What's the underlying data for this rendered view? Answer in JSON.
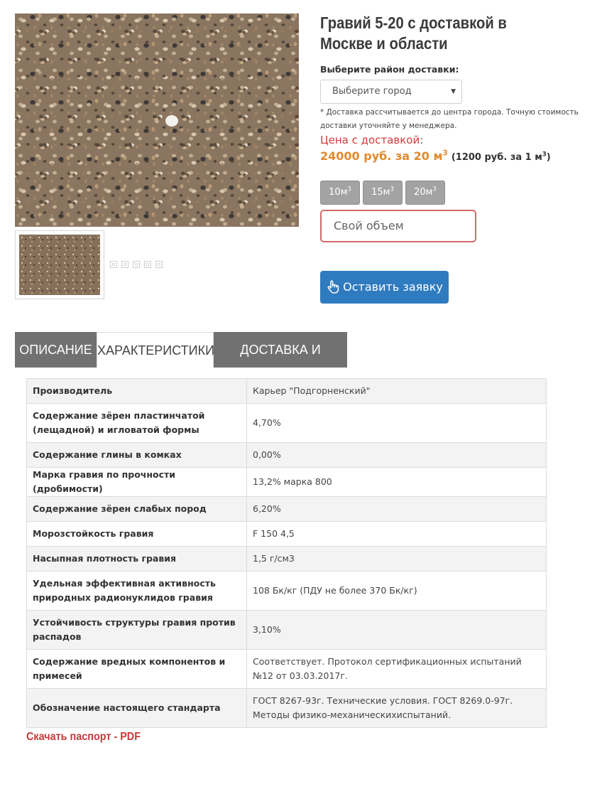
{
  "product": {
    "title": "Гравий 5-20 с доставкой в Москве и области"
  },
  "delivery": {
    "district_label": "Выберите район доставки:",
    "city_select_value": "Выберите город",
    "note": "* Доставка рассчитывается до центра города. Точную стоимость доставки уточняйте у менеджера."
  },
  "price": {
    "label": "Цена с доставкой:",
    "main_text": "24000 руб. за 20 м",
    "main_sup": "3",
    "unit_text": "(1200 руб. за 1 м",
    "unit_sup": "3",
    "unit_close": ")"
  },
  "volume_buttons": [
    {
      "label": "10м",
      "sup": "3"
    },
    {
      "label": "15м",
      "sup": "3"
    },
    {
      "label": "20м",
      "sup": "3"
    }
  ],
  "custom_volume": {
    "placeholder": "Свой объем"
  },
  "order_button": {
    "label": "Оставить заявку",
    "icon": "pointer-hand-icon"
  },
  "tabs": [
    {
      "label": "ОПИСАНИЕ",
      "active": false
    },
    {
      "label": "ХАРАКТЕРИСТИКИ",
      "active": true
    },
    {
      "label": "ДОСТАВКА И ОПЛАТА",
      "active": false
    }
  ],
  "specs": [
    {
      "name": "Производитель",
      "value": "Карьер \"Подгорненский\""
    },
    {
      "name": "Содержание зёрен пластинчатой (лещадной) и игловатой формы",
      "value": "4,70%"
    },
    {
      "name": "Содержание глины в комках",
      "value": "0,00%"
    },
    {
      "name": "Марка гравия по прочности (дробимости)",
      "value": "13,2% марка 800"
    },
    {
      "name": "Содержание зёрен слабых пород",
      "value": "6,20%"
    },
    {
      "name": "Морозстойкость гравия",
      "value": "F 150 4,5"
    },
    {
      "name": "Насыпная плотность гравия",
      "value": "1,5 г/см3"
    },
    {
      "name": "Удельная эффективная активность природных радионуклидов гравия",
      "value": "108 Бк/кг (ПДУ не более 370 Бк/кг)"
    },
    {
      "name": "Устойчивость структуры гравия против распадов",
      "value": "3,10%"
    },
    {
      "name": "Содержание вредных компонентов и примесей",
      "value": "Соответствует. Протокол сертификационных испытаний №12 от 03.03.2017г."
    },
    {
      "name": "Обозначение настоящего стандарта",
      "value": "ГОСТ 8267-93г. Технические условия. ГОСТ 8269.0-97г. Методы физико-механическихиспытаний."
    }
  ],
  "download": {
    "label": "Скачать паспорт - PDF"
  },
  "colors": {
    "price_label": "#d23b3b",
    "price_value": "#e08a2e",
    "order_button": "#2f7bc0",
    "tab_inactive": "#717171",
    "pdf_link": "#c63a3a"
  }
}
